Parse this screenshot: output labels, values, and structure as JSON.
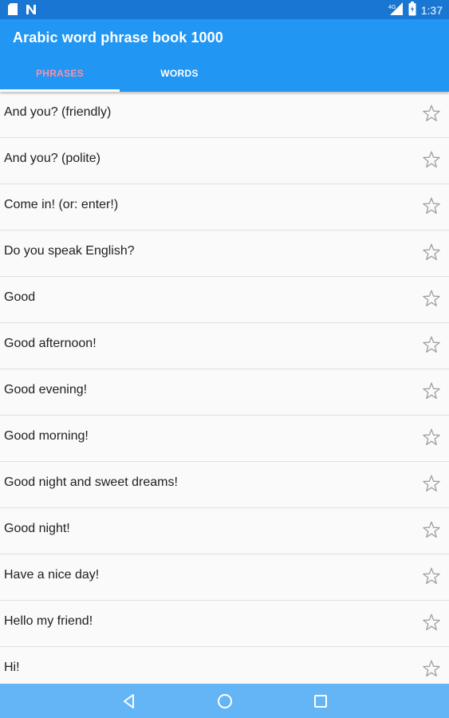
{
  "status_bar": {
    "time": "1:37",
    "network_label": "4G",
    "left_icons": [
      "sd-card-icon",
      "n-notification-icon"
    ],
    "right_icons": [
      "signal-icon",
      "battery-icon"
    ]
  },
  "app_bar": {
    "title": "Arabic word phrase book 1000",
    "color": "#2196F3"
  },
  "tabs": [
    {
      "label": "PHRASES",
      "selected": true,
      "color": "#ff8fa5"
    },
    {
      "label": "WORDS",
      "selected": false,
      "color": "#ffffff"
    }
  ],
  "phrases": [
    {
      "text": "And you? (friendly)",
      "favorite": false
    },
    {
      "text": "And you? (polite)",
      "favorite": false
    },
    {
      "text": "Come in! (or: enter!)",
      "favorite": false
    },
    {
      "text": "Do you speak English?",
      "favorite": false
    },
    {
      "text": "Good",
      "favorite": false
    },
    {
      "text": "Good afternoon!",
      "favorite": false
    },
    {
      "text": "Good evening!",
      "favorite": false
    },
    {
      "text": "Good morning!",
      "favorite": false
    },
    {
      "text": "Good night and sweet dreams!",
      "favorite": false
    },
    {
      "text": "Good night!",
      "favorite": false
    },
    {
      "text": "Have a nice day!",
      "favorite": false
    },
    {
      "text": "Hello my friend!",
      "favorite": false
    },
    {
      "text": "Hi!",
      "favorite": false
    }
  ],
  "nav_bar": {
    "buttons": [
      "back-icon",
      "home-icon",
      "recents-icon"
    ],
    "color": "#64B5F6"
  }
}
